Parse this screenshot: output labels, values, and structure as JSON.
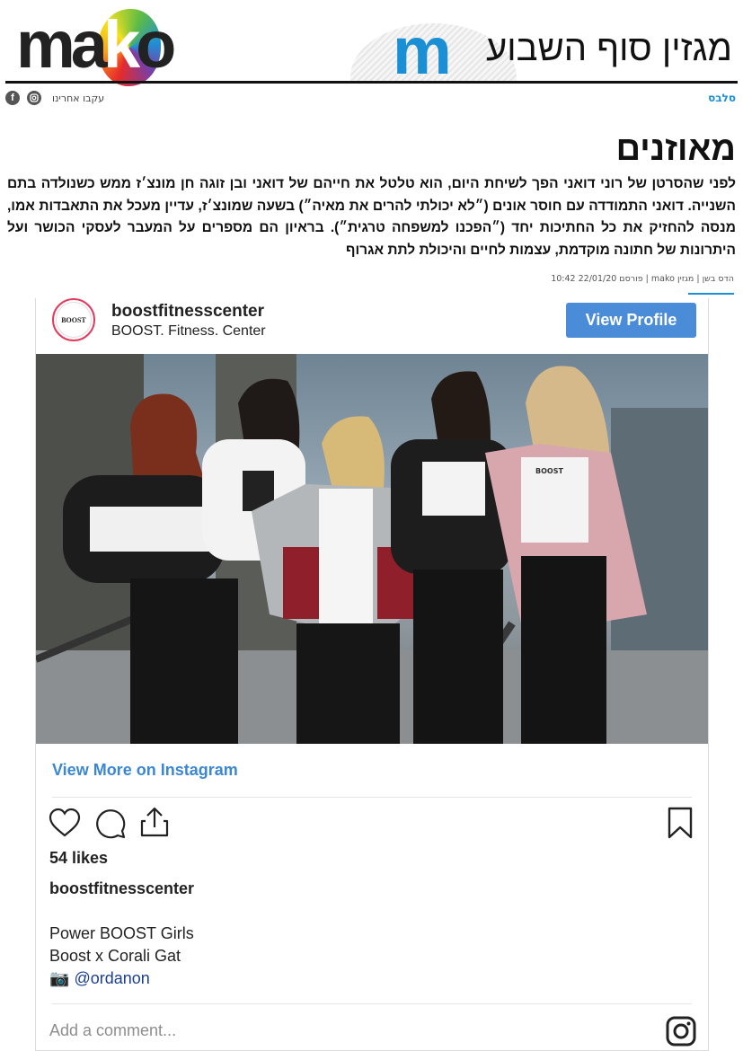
{
  "header": {
    "mako_logo": "mako",
    "magazine_logo_letter": "m",
    "magazine_title": "מגזין סוף השבוע"
  },
  "social": {
    "follow_label": "עקבו אחרינו",
    "icons": [
      "facebook-icon",
      "instagram-icon"
    ]
  },
  "article": {
    "category": "סלבס",
    "headline": "מאוזנים",
    "lead": "לפני שהסרטן של רוני דואני הפך לשיחת היום, הוא טלטל את חייהם של דואני ובן זוגה חן מונצ׳ז ממש כשנולדה בתם השנייה. דואני התמודדה עם חוסר אונים (״לא יכולתי להרים את מאיה״) בשעה שמונצ׳ז, עדיין מעכל את התאבדות אמו, מנסה להחזיק את כל החתיכות יחד (״הפכנו למשפחה טרגית״). בראיון הם מספרים על המעבר לעסקי הכושר ועל היתרונות של חתונה מוקדמת, עצמות לחיים והיכולת לתת אגרוף",
    "meta": "הדס בשן | מגזין mako | פורסם 22/01/20 10:42"
  },
  "instagram": {
    "username": "boostfitnesscenter",
    "subtitle": "BOOST. Fitness. Center",
    "avatar_text": "BOOST",
    "view_profile": "View Profile",
    "view_more": "View More on Instagram",
    "likes": "54 likes",
    "caption_user": "boostfitnesscenter",
    "caption_lines": [
      "Power BOOST Girls",
      "Boost x Corali Gat"
    ],
    "camera_emoji": "📷",
    "mention": "@ordanon",
    "comment_placeholder": "Add a comment...",
    "photo_shirt_text": "BOOST"
  },
  "colors": {
    "accent": "#1a8fd4",
    "ig_button": "#4b8cd9",
    "ig_link": "#3b87d3"
  }
}
